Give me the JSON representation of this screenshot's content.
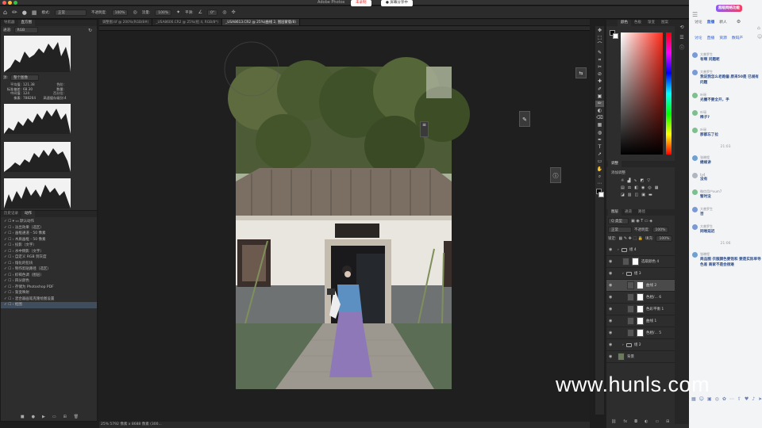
{
  "titlebar": {
    "app_title": "Adobe Photos",
    "record_label": "未录制",
    "share_label": "● 屏幕分享中"
  },
  "options": {
    "mode_label": "模式:",
    "mode_value": "正常",
    "opacity_label": "不透明度:",
    "opacity_value": "100%",
    "flow_label": "流量:",
    "flow_value": "100%",
    "smooth_label": "平滑:",
    "angle_value": "0°"
  },
  "left": {
    "nav_tabs": [
      "导航器",
      "直方图"
    ],
    "channel_label": "通道:",
    "channel_value": "RGB",
    "source_label": "源:",
    "source_value": "整个图像",
    "stats": [
      [
        "平均值:",
        "121.38",
        "色阶:",
        ""
      ],
      [
        "标准偏差:",
        "68.30",
        "数量:",
        ""
      ],
      [
        "中间值:",
        "124",
        "百分位:",
        ""
      ],
      [
        "像素:",
        "788264",
        "高速缓存级别:",
        "4"
      ]
    ],
    "history_tabs": [
      "历史记录",
      "动作"
    ],
    "actions": [
      "默认动作",
      "淡出效果（选区）",
      "画框通道 - 50 像素",
      "木质画框 - 50 像素",
      "投影（文字）",
      "水中倒影（文字）",
      "自定义 RGB 到灰度",
      "熔化的铅块",
      "制作剪贴路径（选区）",
      "棕褐色调（图层）",
      "四分颜色",
      "存储为 Photoshop PDF",
      "渐变映射",
      "混合器画笔克隆绘图设置",
      "抠图"
    ]
  },
  "doc": {
    "tabs": [
      "调整图.tif @ 200%(RGB/8#)",
      "_USA8606.CR2 @ 25%(组 4, RGB/8*)",
      "_USA8613.CR2 @ 25%(曲线 2, 图层蒙版/8)"
    ],
    "status": "25%   5792 像素 x 8688 像素 (300..."
  },
  "toolbar": {
    "tools": [
      "✥",
      "⬚",
      "⌒",
      "✎",
      "⌗",
      "✂",
      "⊘",
      "✚",
      "✐",
      "▣",
      "✏",
      "◐",
      "⌫",
      "▦",
      "◍",
      "✒",
      "T",
      "➚",
      "▭",
      "✋",
      "⌕",
      "⋯"
    ]
  },
  "right": {
    "color_tabs": [
      "颜色",
      "色板",
      "渐变",
      "图案"
    ],
    "adjust_tabs": [
      "调整"
    ],
    "adjust_label": "添加调整",
    "layer_tabs": [
      "图层",
      "通道",
      "路径"
    ],
    "kind_label": "Q 类型",
    "blend_value": "正常",
    "opacity_label": "不透明度:",
    "opacity_value": "100%",
    "lock_label": "锁定:",
    "fill_label": "填充:",
    "fill_value": "100%",
    "layers": [
      {
        "name": "组 4",
        "type": "folder",
        "indent": 0
      },
      {
        "name": "选取颜色 4",
        "type": "adj",
        "indent": 1
      },
      {
        "name": "组 3",
        "type": "folder",
        "indent": 1
      },
      {
        "name": "曲线 2",
        "type": "adj",
        "indent": 2,
        "selected": true
      },
      {
        "name": "色相/... 6",
        "type": "adj",
        "indent": 2
      },
      {
        "name": "色彩平衡 1",
        "type": "adj",
        "indent": 2
      },
      {
        "name": "曲线 1",
        "type": "adj",
        "indent": 2
      },
      {
        "name": "色相/... 5",
        "type": "adj",
        "indent": 2
      },
      {
        "name": "组 2",
        "type": "folder",
        "indent": 1
      },
      {
        "name": "背景",
        "type": "photo",
        "indent": 0
      }
    ]
  },
  "chat": {
    "badge": "超级网络功能",
    "tabs": [
      "讨论",
      "直播",
      "聊天",
      "资料",
      "数码产"
    ],
    "tab_items": [
      "讨论",
      "直播",
      "新人",
      "资源",
      "数码产"
    ],
    "messages": [
      {
        "user": "大普罗生",
        "text": "有啊 问题呢",
        "color": "#7a9ad6"
      },
      {
        "user": "大普罗生",
        "text": "我说我怎么老跑偏 原来50是 已规有问题",
        "color": "#7a9ad6"
      },
      {
        "user": "叶瑶",
        "text": "光圈不要全开，手",
        "color": "#7cc08e"
      },
      {
        "user": "叶瑶",
        "text": "稀子?",
        "color": "#7cc08e"
      },
      {
        "user": "叶瑶",
        "text": "那都忘了拉",
        "color": "#7cc08e"
      }
    ],
    "time1": "21:03",
    "messages2": [
      {
        "user": "张晓程",
        "text": "继续讲",
        "color": "#6fa0d0"
      },
      {
        "user": "ty4",
        "text": "没有",
        "color": "#b0b6c0"
      },
      {
        "user": "微信用户xum7",
        "text": "暂时没",
        "color": "#7cc08e"
      },
      {
        "user": "大普罗生",
        "text": "否",
        "color": "#7a9ad6"
      },
      {
        "user": "大普罗生",
        "text": "同唯延迟",
        "color": "#7a9ad6"
      }
    ],
    "time2": "21:06",
    "messages3": [
      {
        "user": "张晓程",
        "text": "商品图 衣服颜色要饱和 要是实际单导色差 商家不是会很难",
        "color": "#6fa0d0"
      }
    ]
  },
  "watermark": "www.hunls.com"
}
